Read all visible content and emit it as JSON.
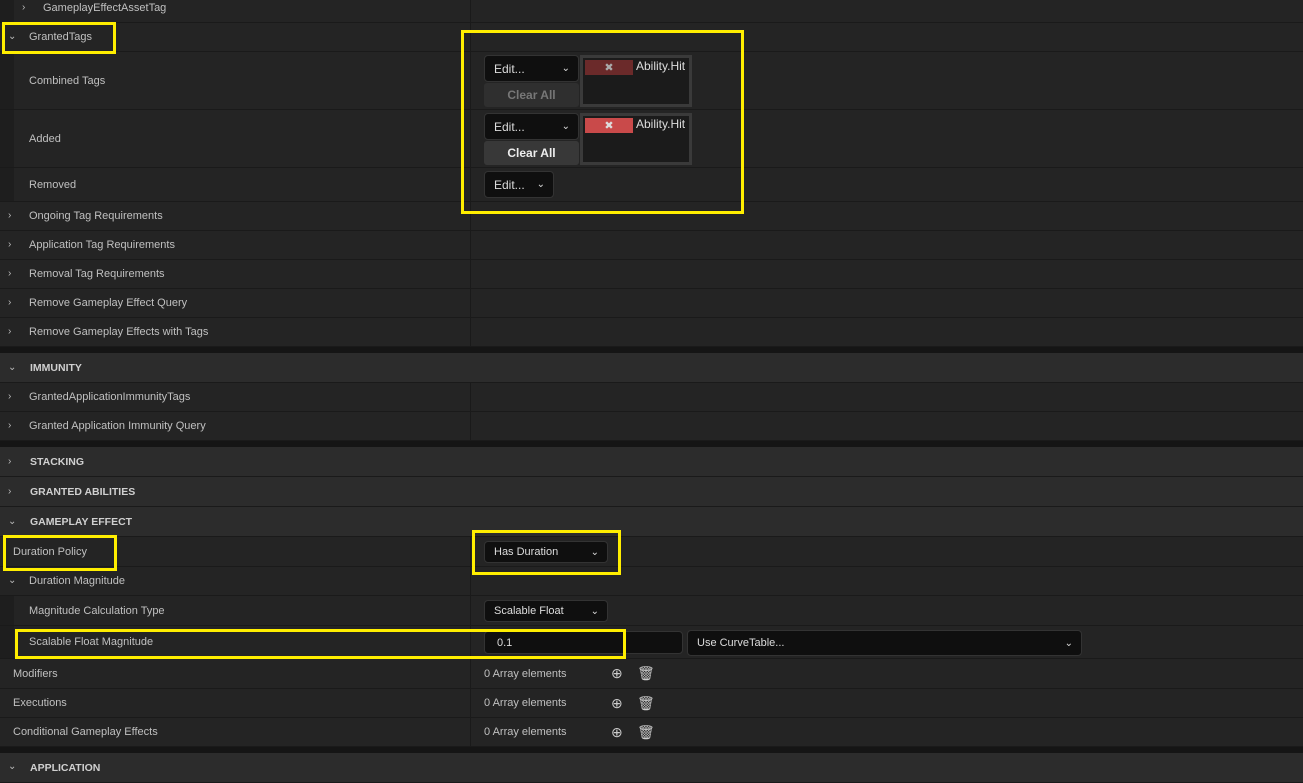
{
  "rows": {
    "asset_tag": "GameplayEffectAssetTag",
    "granted_tags": "GrantedTags",
    "combined_tags": "Combined Tags",
    "added": "Added",
    "removed": "Removed",
    "ongoing": "Ongoing Tag Requirements",
    "application_req": "Application Tag Requirements",
    "removal_req": "Removal Tag Requirements",
    "remove_query": "Remove Gameplay Effect Query",
    "remove_with_tags": "Remove Gameplay Effects with Tags",
    "immunity_tags": "GrantedApplicationImmunityTags",
    "immunity_query": "Granted Application Immunity Query",
    "duration_policy": "Duration Policy",
    "duration_magnitude": "Duration Magnitude",
    "mag_calc_type": "Magnitude Calculation Type",
    "scalable_float": "Scalable Float Magnitude",
    "modifiers": "Modifiers",
    "executions": "Executions",
    "conditional": "Conditional Gameplay Effects"
  },
  "sections": {
    "immunity": "IMMUNITY",
    "stacking": "STACKING",
    "granted_abilities": "GRANTED ABILITIES",
    "gameplay_effect": "GAMEPLAY EFFECT",
    "application": "APPLICATION"
  },
  "values": {
    "edit_label": "Edit...",
    "clear_all": "Clear All",
    "tag": "Ability.Hit",
    "tag_remove_glyph": "✖",
    "duration_policy": "Has Duration",
    "mag_calc_type": "Scalable Float",
    "scalable_value": "0.1",
    "curve_table": "Use CurveTable...",
    "array_elements": "0 Array elements"
  },
  "colors": {
    "highlight": "#ffee00",
    "tag_active": "#c94a4a",
    "tag_disabled": "#6b2a2a"
  },
  "icons": {
    "expanded": "chevron-down-icon",
    "collapsed": "chevron-right-icon",
    "add": "plus-circle-icon",
    "delete": "trash-icon"
  }
}
